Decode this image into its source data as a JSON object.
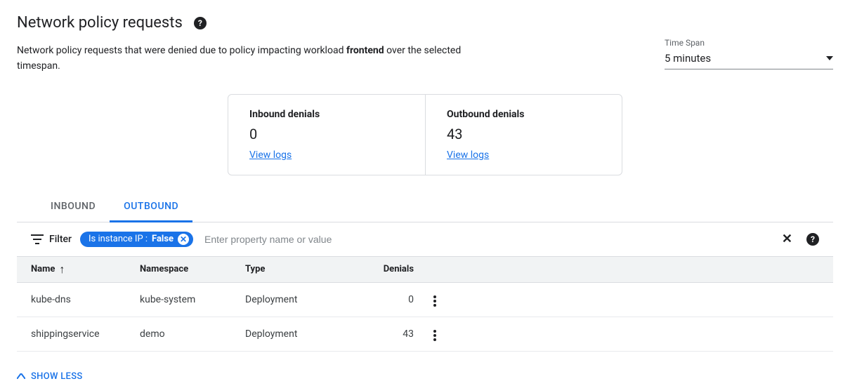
{
  "header": {
    "title": "Network policy requests",
    "description_prefix": "Network policy requests that were denied due to policy impacting workload ",
    "description_bold": "frontend",
    "description_suffix": " over the selected timespan."
  },
  "timespan": {
    "label": "Time Span",
    "value": "5 minutes"
  },
  "cards": {
    "inbound": {
      "label": "Inbound denials",
      "value": "0",
      "link": "View logs"
    },
    "outbound": {
      "label": "Outbound denials",
      "value": "43",
      "link": "View logs"
    }
  },
  "tabs": {
    "inbound": "Inbound",
    "outbound": "Outbound"
  },
  "filter": {
    "label": "Filter",
    "chip_key": "Is instance IP :",
    "chip_value": "False",
    "placeholder": "Enter property name or value"
  },
  "table": {
    "headers": {
      "name": "Name",
      "namespace": "Namespace",
      "type": "Type",
      "denials": "Denials"
    },
    "rows": [
      {
        "name": "kube-dns",
        "namespace": "kube-system",
        "type": "Deployment",
        "denials": "0"
      },
      {
        "name": "shippingservice",
        "namespace": "demo",
        "type": "Deployment",
        "denials": "43"
      }
    ]
  },
  "show_less": "Show less"
}
